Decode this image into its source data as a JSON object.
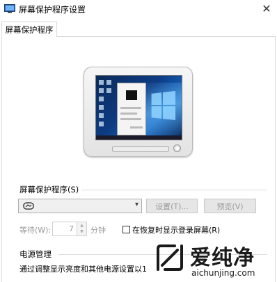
{
  "window": {
    "title": "屏幕保护程序设置",
    "close_glyph": "✕"
  },
  "tabs": [
    {
      "label": "屏幕保护程序"
    }
  ],
  "screensaver": {
    "group_label": "屏幕保护程序(S)",
    "selected_value": "",
    "settings_button": "设置(T)...",
    "preview_button": "预览(V)",
    "wait_label": "等待(W):",
    "wait_value": "7",
    "wait_unit": "分钟",
    "resume_checkbox_label": "在恢复时显示登录屏幕(R)",
    "resume_checked": false
  },
  "power": {
    "title": "电源管理",
    "description": "通过调整显示亮度和其他电源设置以1"
  },
  "watermark": {
    "title": "爱纯净",
    "url": "aichunjing.com"
  }
}
